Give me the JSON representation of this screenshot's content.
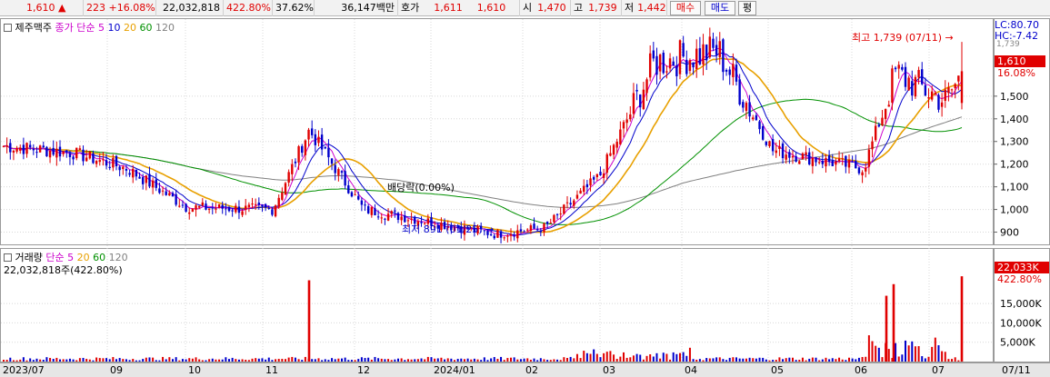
{
  "quote": {
    "price": "1,610",
    "arrow": "▲",
    "change": "223",
    "change_pct": "+16.08%",
    "volume": "22,032,818",
    "volume_ratio": "422.80%",
    "turnover": "37.62%",
    "amount": "36,147백만",
    "bid_label": "호가",
    "bid1": "1,611",
    "bid2": "1,610",
    "open_label": "시",
    "open": "1,470",
    "high_label": "고",
    "high": "1,739",
    "low_label": "저",
    "low": "1,442",
    "buy_button": "매수",
    "sell_button": "매도",
    "flat_button": "평"
  },
  "price_legend": {
    "stock_name": "제주맥주",
    "ma_label": "종가 단순",
    "ma5": "5",
    "ma10": "10",
    "ma20": "20",
    "ma60": "60",
    "ma120": "120"
  },
  "volume_legend": {
    "label": "거래량",
    "ma_label": "단순",
    "ma5": "5",
    "ma20": "20",
    "ma60": "60",
    "ma120": "120",
    "current": "22,032,818주(422.80%)"
  },
  "right_axis": {
    "lc": "LC:80.70",
    "hc": "HC:-7.42",
    "hc_sub": "1,739",
    "last_price_tag": "1,610",
    "last_pct_tag": "16.08%",
    "last_volume_tag": "22,033K",
    "last_volume_pct": "422.80%"
  },
  "annotations": {
    "high_note": "최고 1,739 (07/11)",
    "low_note": "최저 891 (01/25)",
    "dividend_note": "배당락(0.00%)"
  },
  "colors": {
    "up": "#e00000",
    "down": "#0000cc",
    "ma5": "#cc00cc",
    "ma10": "#0000cc",
    "ma20": "#e8a000",
    "ma60": "#009000",
    "ma120": "#808080",
    "grid": "#d8d8d8"
  },
  "chart_data": [
    {
      "type": "candlestick",
      "title": "제주맥주",
      "x_ticks": [
        "2023/07",
        "09",
        "10",
        "11",
        "12",
        "2024/01",
        "02",
        "03",
        "04",
        "05",
        "06",
        "07",
        "07/11"
      ],
      "y_ticks": [
        "900",
        "1,000",
        "1,100",
        "1,200",
        "1,300",
        "1,400",
        "1,500"
      ],
      "ylim": [
        850,
        1780
      ],
      "grid": true,
      "legend": "top-left",
      "key_points": [
        {
          "date": "2023/07",
          "close": 1280
        },
        {
          "date": "2023/08",
          "close": 1250
        },
        {
          "date": "2023/09",
          "close": 1180
        },
        {
          "date": "2023/10",
          "close": 1010
        },
        {
          "date": "2023/11",
          "close": 1000
        },
        {
          "date": "2023/11 late",
          "close": 1350
        },
        {
          "date": "2023/12",
          "close": 1000
        },
        {
          "date": "2024/01/25",
          "close": 891
        },
        {
          "date": "2024/02",
          "close": 920
        },
        {
          "date": "2024/03",
          "close": 1150
        },
        {
          "date": "2024/03 late",
          "close": 1650
        },
        {
          "date": "2024/04",
          "close": 1700
        },
        {
          "date": "2024/05",
          "close": 1260
        },
        {
          "date": "2024/06",
          "close": 1180
        },
        {
          "date": "2024/06 late",
          "close": 1600
        },
        {
          "date": "2024/07",
          "close": 1480
        },
        {
          "date": "2024/07/11",
          "open": 1470,
          "high": 1739,
          "low": 1442,
          "close": 1610
        }
      ],
      "moving_averages": [
        {
          "name": "5",
          "color": "#cc00cc"
        },
        {
          "name": "10",
          "color": "#0000cc"
        },
        {
          "name": "20",
          "color": "#e8a000"
        },
        {
          "name": "60",
          "color": "#009000"
        },
        {
          "name": "120",
          "color": "#808080"
        }
      ]
    },
    {
      "type": "bar",
      "title": "거래량",
      "y_ticks": [
        "5,000K",
        "10,000K",
        "15,000K"
      ],
      "ylim": [
        0,
        23000
      ],
      "last_value": 22032818,
      "spikes": [
        {
          "date": "2023/11 late",
          "value": 21000000
        },
        {
          "date": "2024/06 late",
          "value": 17000000
        },
        {
          "date": "2024/06 late 2",
          "value": 20000000
        },
        {
          "date": "2024/07/11",
          "value": 22032818
        }
      ]
    }
  ]
}
